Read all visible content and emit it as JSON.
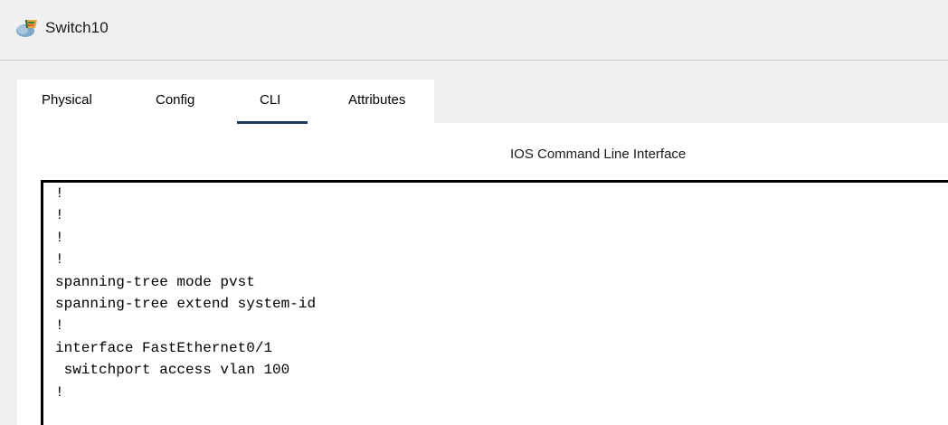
{
  "window": {
    "title": "Switch10",
    "icon": "packet-tracer-switch-icon"
  },
  "tabs": [
    {
      "label": "Physical",
      "active": false
    },
    {
      "label": "Config",
      "active": false
    },
    {
      "label": "CLI",
      "active": true
    },
    {
      "label": "Attributes",
      "active": false
    }
  ],
  "cli": {
    "heading": "IOS Command Line Interface",
    "lines": [
      "!",
      "!",
      "!",
      "!",
      "spanning-tree mode pvst",
      "spanning-tree extend system-id",
      "!",
      "interface FastEthernet0/1",
      " switchport access vlan 100",
      "!"
    ]
  },
  "colors": {
    "window_bg": "#f0f0f0",
    "panel_bg": "#ffffff",
    "active_tab_underline": "#1f3a5f",
    "cli_border": "#000000"
  }
}
